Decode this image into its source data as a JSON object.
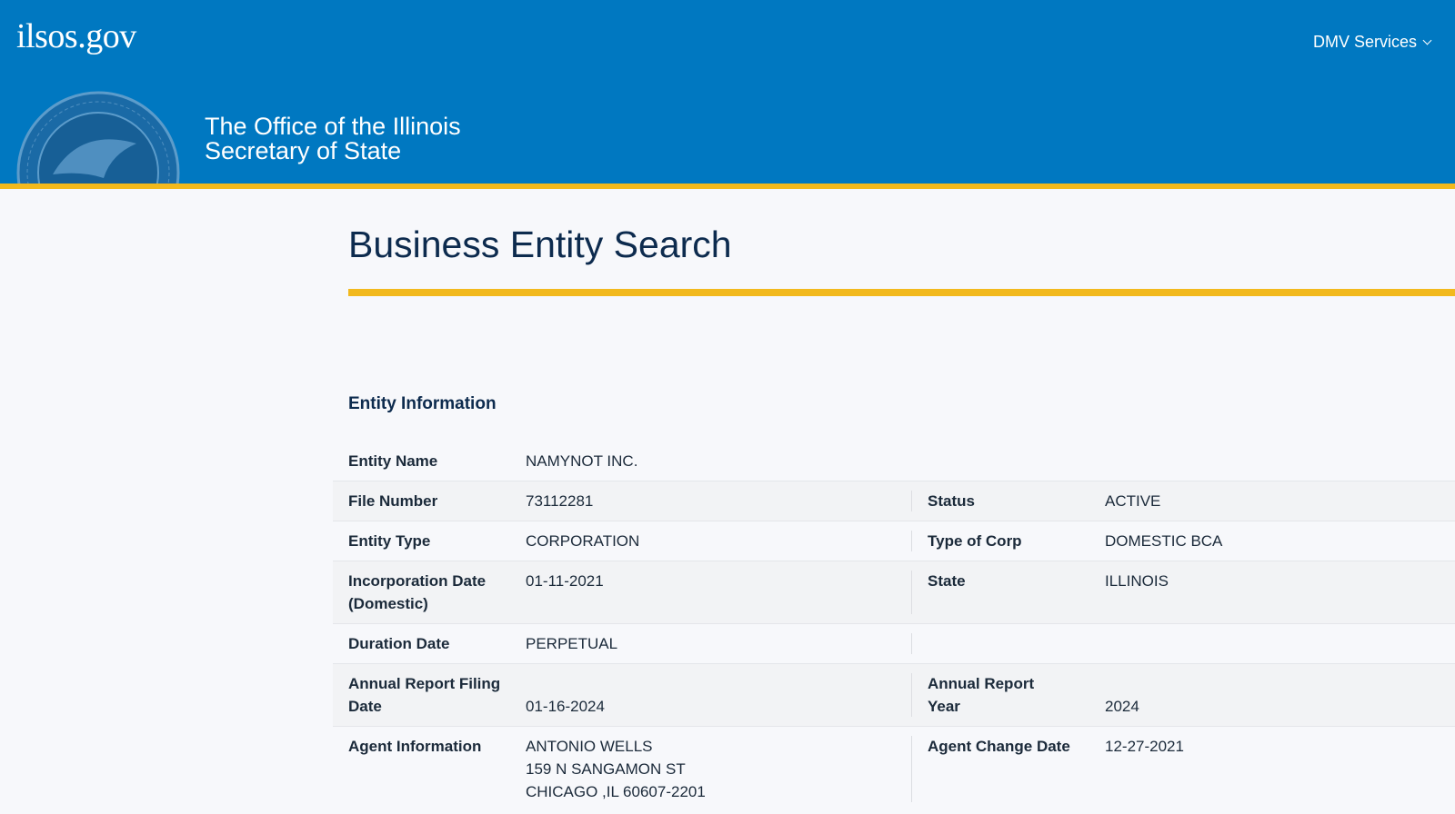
{
  "header": {
    "logo_text": "ilsos.gov",
    "dmv_label": "DMV Services",
    "office_line1": "The Office of the Illinois",
    "office_line2": "Secretary of State",
    "colors": {
      "header_bg": "#0078c1",
      "accent": "#f2b91d"
    }
  },
  "page": {
    "title": "Business Entity Search",
    "section_title": "Entity Information"
  },
  "entity": {
    "name_label": "Entity Name",
    "name_value": "NAMYNOT INC.",
    "file_number_label": "File Number",
    "file_number_value": "73112281",
    "status_label": "Status",
    "status_value": "ACTIVE",
    "entity_type_label": "Entity Type",
    "entity_type_value": "CORPORATION",
    "type_of_corp_label": "Type of Corp",
    "type_of_corp_value": "DOMESTIC BCA",
    "incorporation_label_1": "Incorporation Date",
    "incorporation_label_2": "(Domestic)",
    "incorporation_value": "01-11-2021",
    "state_label": "State",
    "state_value": "ILLINOIS",
    "duration_label": "Duration Date",
    "duration_value": "PERPETUAL",
    "annual_filing_label_1": "Annual Report Filing",
    "annual_filing_label_2": "Date",
    "annual_filing_value": "01-16-2024",
    "annual_year_label_1": "Annual Report",
    "annual_year_label_2": "Year",
    "annual_year_value": "2024",
    "agent_label": "Agent Information",
    "agent_name": "ANTONIO WELLS",
    "agent_street": "159 N SANGAMON ST",
    "agent_city": "CHICAGO ,IL 60607-2201",
    "agent_change_label": "Agent Change Date",
    "agent_change_value": "12-27-2021"
  }
}
